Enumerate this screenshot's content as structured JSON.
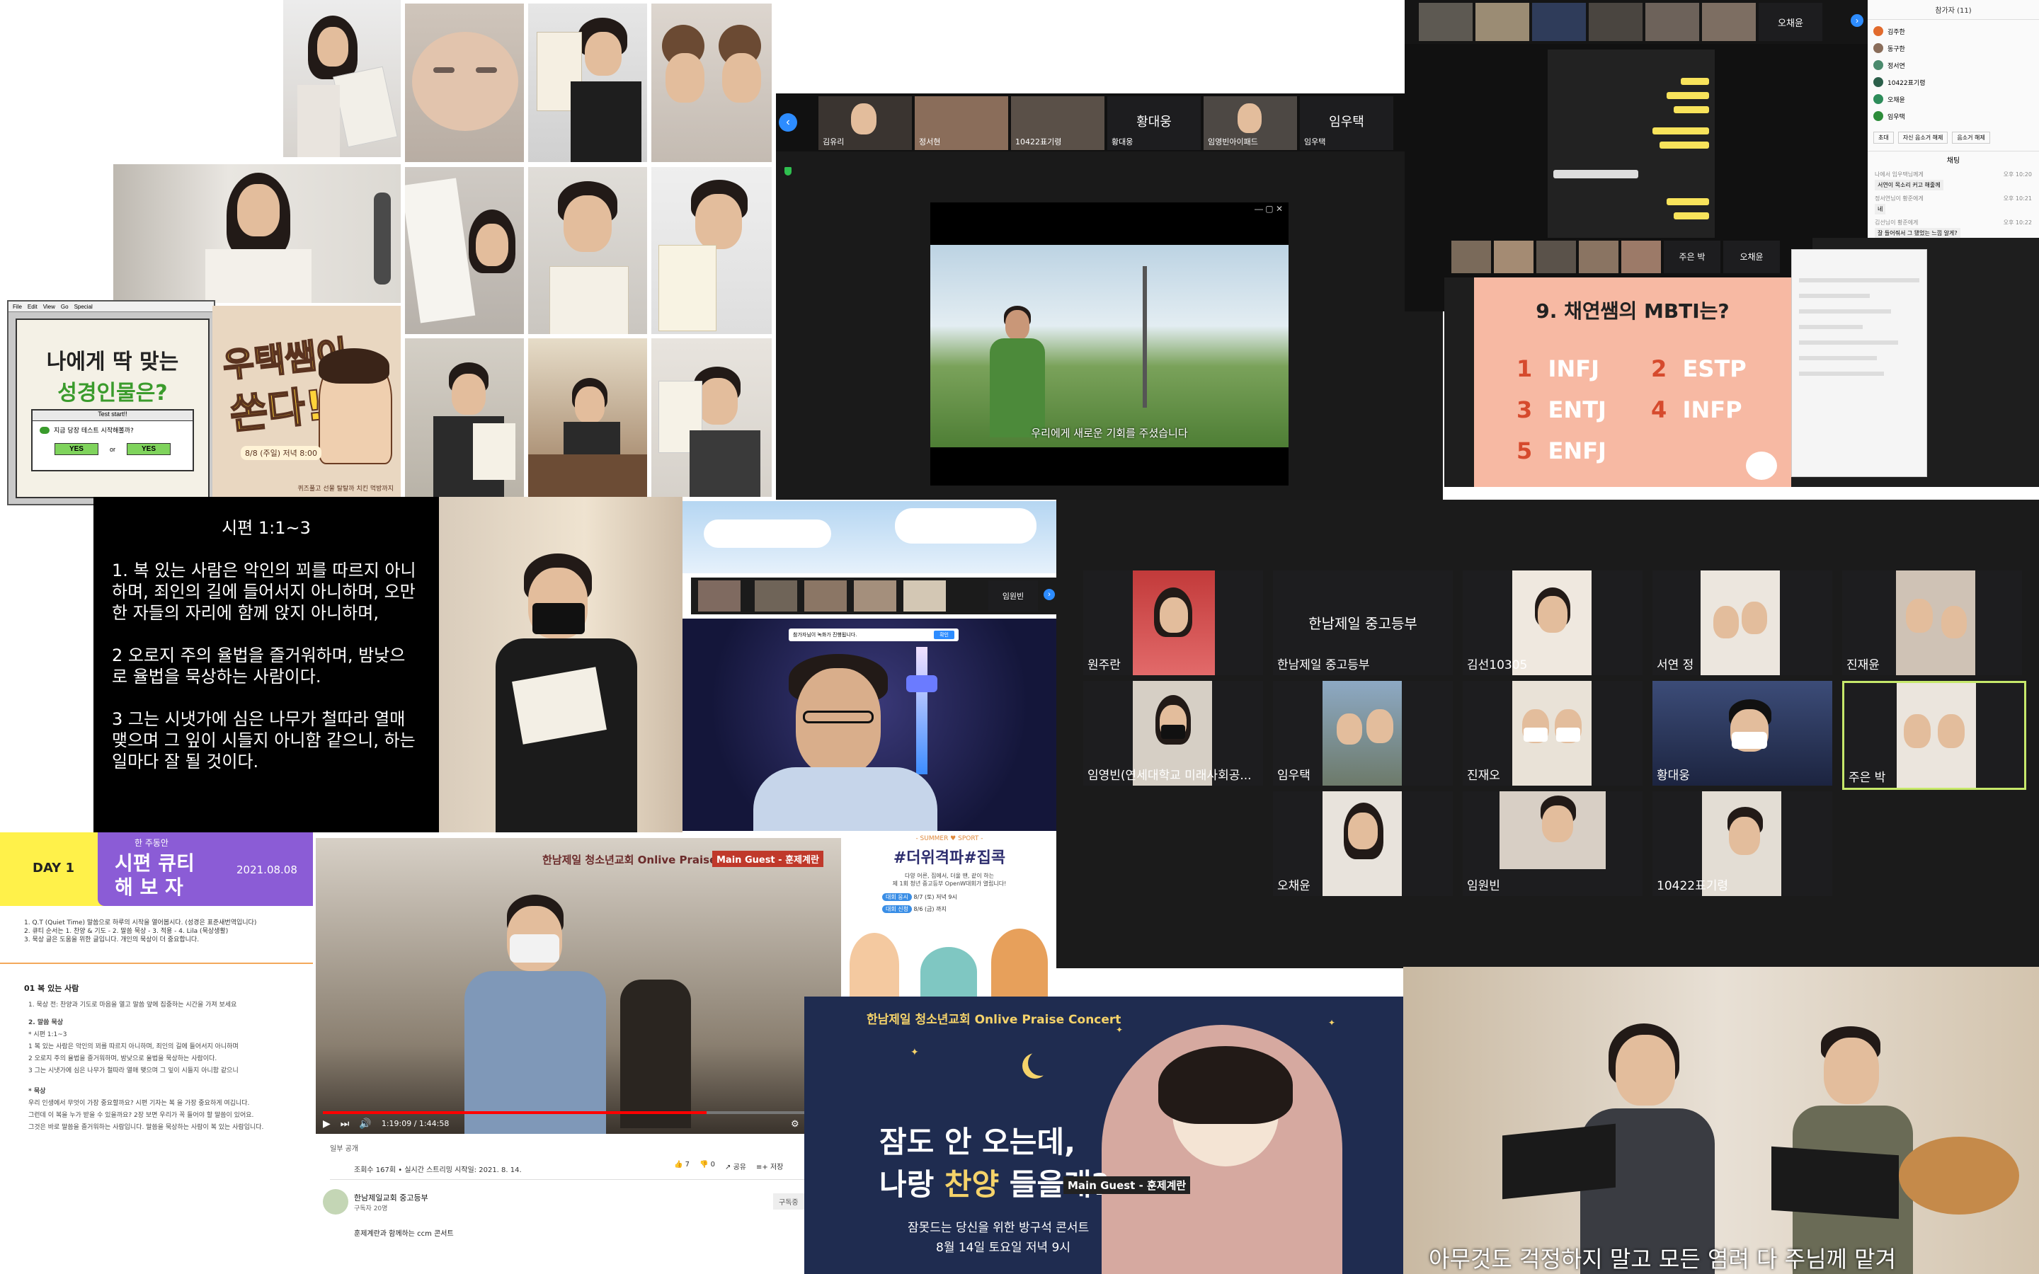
{
  "colors": {
    "zoom_dark": "#1d1d1f",
    "accent_purple": "#8b5cd6",
    "accent_yellow": "#ffe600",
    "slide_pink": "#f7b9a3",
    "concert_navy": "#1f2c50",
    "youtube_red": "#ff0000"
  },
  "collage": {
    "personality_test": {
      "menu": [
        "File",
        "Edit",
        "View",
        "Go",
        "Special"
      ],
      "title_line1": "나에게 딱 맞는",
      "title_line2": "성경인물은?",
      "dialog_title": "Test start!!",
      "dialog_text": "지금 당장 테스트 시작해볼까?",
      "yes_label": "YES",
      "or_label": "or"
    },
    "poster": {
      "headline_line1": "우택쌤이",
      "headline_line2": "쏜다!",
      "date_text": "8/8 (주일) 저녁 8:00",
      "footer_text": "퀴즈풀고 선물 탈탈까 치킨 먹방까지"
    },
    "zoom_video": {
      "participants": [
        "김유리",
        "정서현",
        "10422표기령",
        "황대웅",
        "임영빈아이패드",
        "임우택"
      ],
      "big_names": [
        "황대웅",
        "임우택"
      ],
      "subtitle": "우리에게 새로운 기회를 주셨습니다"
    },
    "zoom_chat": {
      "top_name": "오채윤",
      "panel_title": "참가자 (11)",
      "participants": [
        "김주한",
        "동구한",
        "정서연",
        "10422표기령",
        "오채윤",
        "임우택"
      ],
      "panel_buttons": [
        "초대",
        "자신 음소거 해제",
        "음소거 해제"
      ],
      "chat_title": "채팅",
      "chat_messages": [
        {
          "sender": "나에서 임우택님께게",
          "time": "오후 10:20",
          "text": "서연이 목소리 커고 해줄께"
        },
        {
          "sender": "정서연님이 황준에게",
          "time": "오후 10:21",
          "text": "네"
        },
        {
          "sender": "김선님이 황준에게",
          "time": "오후 10:22",
          "text": "잘 들어줘서 그 됐었는 느낌 알게?"
        }
      ]
    },
    "mbti_quiz": {
      "top_names": [
        "주은 박",
        "오채윤"
      ],
      "question": "9. 채연쌤의 MBTI는?",
      "options": [
        {
          "num": "1",
          "label": "INFJ"
        },
        {
          "num": "2",
          "label": "ESTP"
        },
        {
          "num": "3",
          "label": "ENTJ"
        },
        {
          "num": "4",
          "label": "INFP"
        },
        {
          "num": "5",
          "label": "ENFJ"
        }
      ]
    },
    "psalm_slide": {
      "title": "시편 1:1~3",
      "verse1": "1. 복 있는 사람은 악인의 꾀를 따르지 아니하며, 죄인의 길에 들어서지 아니하며, 오만한 자들의 자리에 함께 앉지 아니하며,",
      "verse2": "2   오로지 주의 율법을 즐거워하며, 밤낮으로 율법을 묵상하는 사람이다.",
      "verse3": "3   그는 시냇가에 심은 나무가 철따라 열매 맺으며 그 잎이 시들지 아니함 같으니, 하는 일마다 잘 될 것이다."
    },
    "night_zoom": {
      "top_name": "임원빈",
      "notice": "참가자님이 녹화가 진행됩니다.",
      "notice_button": "확인"
    },
    "gallery": {
      "tiles": [
        {
          "name": "원주란",
          "center": ""
        },
        {
          "name": "한남제일 중고등부",
          "center": "한남제일 중고등부"
        },
        {
          "name": "김선10305",
          "center": ""
        },
        {
          "name": "서연 정",
          "center": ""
        },
        {
          "name": "진재윤",
          "center": ""
        },
        {
          "name": "임영빈(연세대학교 미래사회공...",
          "center": ""
        },
        {
          "name": "임우택",
          "center": ""
        },
        {
          "name": "진재오",
          "center": ""
        },
        {
          "name": "황대웅",
          "center": ""
        },
        {
          "name": "주은 박",
          "center": ""
        },
        {
          "name": "오채윤",
          "center": ""
        },
        {
          "name": "임원빈",
          "center": ""
        },
        {
          "name": "10422표기령",
          "center": ""
        }
      ]
    },
    "qt_doc": {
      "day": "DAY 1",
      "subtitle": "한 주동안",
      "title_line1": "시편 큐티",
      "title_line2": "해 보 자",
      "date": "2021.08.08",
      "intro": [
        "1. Q.T (Quiet Time) 말씀으로 하루의 시작을 열어봅시다. (성경은 표준새번역입니다)",
        "2. 큐티 순서는 1. 찬양 & 기도 - 2. 말씀 묵상 - 3. 적용 - 4. Lila (묵상생활)",
        "3. 묵상 글은 도움을 위한 글입니다. 개인의 묵상이 더 중요합니다."
      ],
      "section": "01 복 있는 사람",
      "lines": [
        "1. 묵상 전: 찬양과 기도로 마음을 열고 말씀 앞에 집중하는 시간을 가져 보세요",
        "2. 말씀 묵상",
        "* 시편 1:1~3",
        "1 복 있는 사람은 악인의 꾀를 따르지 아니하며, 죄인의 길에 들어서지 아니하며",
        "2 오로지 주의 율법을 즐거워하며, 밤낮으로 율법을 묵상하는 사람이다.",
        "3 그는 시냇가에 심은 나무가 철따라 열매 맺으며 그 잎이 시들지 아니함 같으니",
        "* 묵상",
        "우리 인생에서 무엇이 가장 중요할까요? 시편 기자는 복 을 가장 중요하게 여깁니다.",
        "그런데 이 복을 누가 받을 수 있을까요? 2장 보면 우리가 꼭 들어야 할 말씀이 있어요.",
        "그것은 바로 말씀을 즐거워하는 사람입니다. 말씀을 묵상하는 사람이 복 있는 사람입니다."
      ]
    },
    "youtube": {
      "header": "한남제일 청소년교회 Onlive Praise Concert",
      "guest_badge": "Main Guest - 훈제계란",
      "time": "1:19:09 / 1:44:58",
      "visibility": "일부 공개",
      "stats": "조회수 167회 • 실시간 스트리밍 시작일: 2021. 8. 14.",
      "likes": "7",
      "dislikes": "0",
      "share": "공유",
      "save": "저장",
      "channel": "한남제일교회 중고등부",
      "subscribers": "구독자 20명",
      "subscribe": "구독중",
      "description": "훈제계란과 함께하는 ccm 콘서트"
    },
    "event_flyer": {
      "tag": "- SUMMER ♥ SPORT -",
      "headline": "#더위격파#집콕",
      "desc_line1": "다양 어른, 집에서, 더울 땐, 같이 하는",
      "desc_line2": "제 1회 청년 중고등부 OpenW대회가 열립니다!",
      "row1_label": "대회 응시",
      "row1_value": "8/7 (토) 저녁 9시",
      "row2_label": "대회 신청",
      "row2_value": "8/6 (금) 까지"
    },
    "concert_poster": {
      "header": "한남제일 청소년교회 Onlive Praise Concert",
      "line1": "잠도 안 오는데,",
      "line2_a": "나랑 ",
      "line2_b": "찬양",
      "line2_c": " 들을래?",
      "guest_badge": "Main Guest - 훈제계란",
      "sub1": "잠못드는 당신을 위한 방구석 콘서트",
      "sub2": "8월 14일 토요일 저녁 9시"
    },
    "live_band": {
      "subtitle": "아무것도 걱정하지 말고 모든 염려 다 주님께 맡겨"
    }
  }
}
